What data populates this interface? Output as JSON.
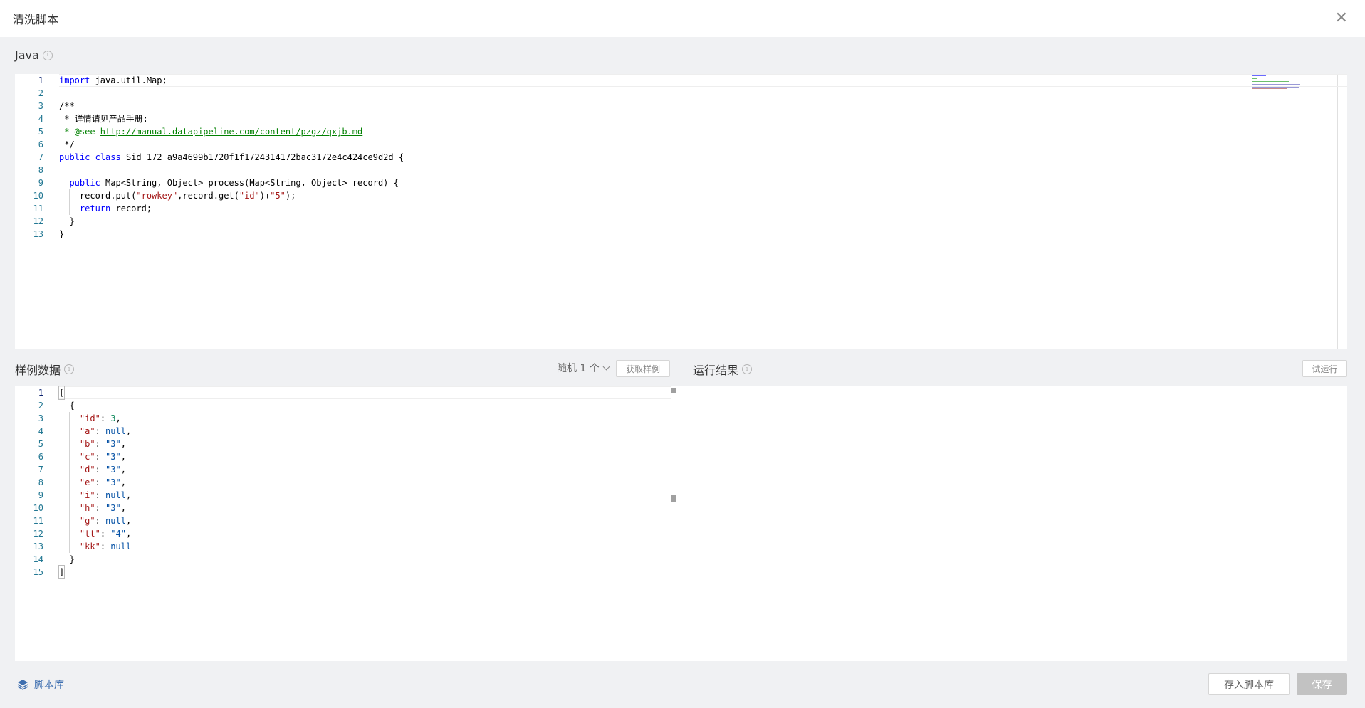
{
  "dialog": {
    "title": "清洗脚本",
    "close_icon": "✕"
  },
  "java_section": {
    "label": "Java",
    "info_icon": "i",
    "lines": [
      {
        "num": "1"
      },
      {
        "num": "2"
      },
      {
        "num": "3"
      },
      {
        "num": "4"
      },
      {
        "num": "5"
      },
      {
        "num": "6"
      },
      {
        "num": "7"
      },
      {
        "num": "8"
      },
      {
        "num": "9"
      },
      {
        "num": "10"
      },
      {
        "num": "11"
      },
      {
        "num": "12"
      },
      {
        "num": "13"
      }
    ],
    "tokens": {
      "l1_kw": "import",
      "l1_rest": " java.util.Map;",
      "l3": "/**",
      "l4": " * 详情请见产品手册:",
      "l5_pre": " * @see ",
      "l5_link": "http://manual.datapipeline.com/content/pzgz/qxjb.md",
      "l6": " */",
      "l7_kw1": "public",
      "l7_sp1": " ",
      "l7_kw2": "class",
      "l7_rest": " Sid_172_a9a4699b1720f1f1724314172bac3172e4c424ce9d2d {",
      "l9_indent": "  ",
      "l9_kw": "public",
      "l9_rest": " Map<String, Object> process(Map<String, Object> record) {",
      "l10_pre": "    record.put(",
      "l10_s1": "\"rowkey\"",
      "l10_mid": ",record.get(",
      "l10_s2": "\"id\"",
      "l10_plus": ")+",
      "l10_s3": "\"5\"",
      "l10_end": ");",
      "l11_indent": "    ",
      "l11_kw": "return",
      "l11_rest": " record;",
      "l12": "  }",
      "l13": "}"
    }
  },
  "sample_section": {
    "label": "样例数据",
    "info_icon": "i",
    "random_select": "随机 1 个",
    "fetch_button": "获取样例",
    "lines": [
      {
        "num": "1"
      },
      {
        "num": "2"
      },
      {
        "num": "3"
      },
      {
        "num": "4"
      },
      {
        "num": "5"
      },
      {
        "num": "6"
      },
      {
        "num": "7"
      },
      {
        "num": "8"
      },
      {
        "num": "9"
      },
      {
        "num": "10"
      },
      {
        "num": "11"
      },
      {
        "num": "12"
      },
      {
        "num": "13"
      },
      {
        "num": "14"
      },
      {
        "num": "15"
      }
    ],
    "json_open": "[",
    "obj_open": "  {",
    "entries": [
      {
        "key": "\"id\"",
        "value": "3",
        "type": "num",
        "comma": ","
      },
      {
        "key": "\"a\"",
        "value": "null",
        "type": "null",
        "comma": ","
      },
      {
        "key": "\"b\"",
        "value": "\"3\"",
        "type": "str",
        "comma": ","
      },
      {
        "key": "\"c\"",
        "value": "\"3\"",
        "type": "str",
        "comma": ","
      },
      {
        "key": "\"d\"",
        "value": "\"3\"",
        "type": "str",
        "comma": ","
      },
      {
        "key": "\"e\"",
        "value": "\"3\"",
        "type": "str",
        "comma": ","
      },
      {
        "key": "\"i\"",
        "value": "null",
        "type": "null",
        "comma": ","
      },
      {
        "key": "\"h\"",
        "value": "\"3\"",
        "type": "str",
        "comma": ","
      },
      {
        "key": "\"g\"",
        "value": "null",
        "type": "null",
        "comma": ","
      },
      {
        "key": "\"tt\"",
        "value": "\"4\"",
        "type": "str",
        "comma": ","
      },
      {
        "key": "\"kk\"",
        "value": "null",
        "type": "null",
        "comma": ""
      }
    ],
    "obj_close": "  }",
    "json_close": "]"
  },
  "result_section": {
    "label": "运行结果",
    "info_icon": "i",
    "run_button": "试运行"
  },
  "footer": {
    "script_library_link": "脚本库",
    "save_to_library_button": "存入脚本库",
    "save_button": "保存"
  },
  "colors": {
    "accent": "#3e6fb0",
    "line_number": "#237893",
    "keyword": "#0000ff",
    "comment": "#008000",
    "string": "#a31515"
  }
}
